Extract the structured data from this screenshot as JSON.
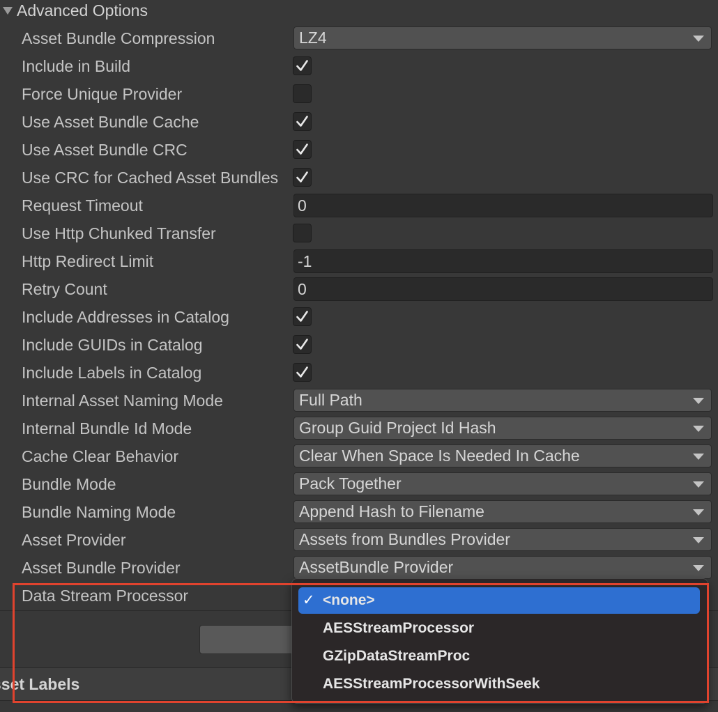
{
  "section": {
    "title": "Advanced Options"
  },
  "fields": [
    {
      "label": "Asset Bundle Compression",
      "type": "dropdown",
      "value": "LZ4"
    },
    {
      "label": "Include in Build",
      "type": "checkbox",
      "checked": true
    },
    {
      "label": "Force Unique Provider",
      "type": "checkbox",
      "checked": false
    },
    {
      "label": "Use Asset Bundle Cache",
      "type": "checkbox",
      "checked": true
    },
    {
      "label": "Use Asset Bundle CRC",
      "type": "checkbox",
      "checked": true
    },
    {
      "label": "Use CRC for Cached Asset Bundles",
      "type": "checkbox",
      "checked": true
    },
    {
      "label": "Request Timeout",
      "type": "text",
      "value": "0"
    },
    {
      "label": "Use Http Chunked Transfer",
      "type": "checkbox",
      "checked": false
    },
    {
      "label": "Http Redirect Limit",
      "type": "text",
      "value": "-1"
    },
    {
      "label": "Retry Count",
      "type": "text",
      "value": "0"
    },
    {
      "label": "Include Addresses in Catalog",
      "type": "checkbox",
      "checked": true
    },
    {
      "label": "Include GUIDs in Catalog",
      "type": "checkbox",
      "checked": true
    },
    {
      "label": "Include Labels in Catalog",
      "type": "checkbox",
      "checked": true
    },
    {
      "label": "Internal Asset Naming Mode",
      "type": "dropdown",
      "value": "Full Path"
    },
    {
      "label": "Internal Bundle Id Mode",
      "type": "dropdown",
      "value": "Group Guid Project Id Hash"
    },
    {
      "label": "Cache Clear Behavior",
      "type": "dropdown",
      "value": "Clear When Space Is Needed In Cache"
    },
    {
      "label": "Bundle Mode",
      "type": "dropdown",
      "value": "Pack Together"
    },
    {
      "label": "Bundle Naming Mode",
      "type": "dropdown",
      "value": "Append Hash to Filename"
    },
    {
      "label": "Asset Provider",
      "type": "dropdown",
      "value": "Assets from Bundles Provider"
    },
    {
      "label": "Asset Bundle Provider",
      "type": "dropdown",
      "value": "AssetBundle Provider"
    },
    {
      "label": "Data Stream Processor",
      "type": "label-only"
    }
  ],
  "popup": {
    "check_glyph": "✓",
    "options": [
      "<none>",
      "AESStreamProcessor",
      "GZipDataStreamProc",
      "AESStreamProcessorWithSeek"
    ],
    "selected_index": 0
  },
  "bottom_section": {
    "title": "sset Labels"
  },
  "colors": {
    "selected": "#2e6fd1",
    "highlight": "#e0432e",
    "background": "#383838"
  }
}
